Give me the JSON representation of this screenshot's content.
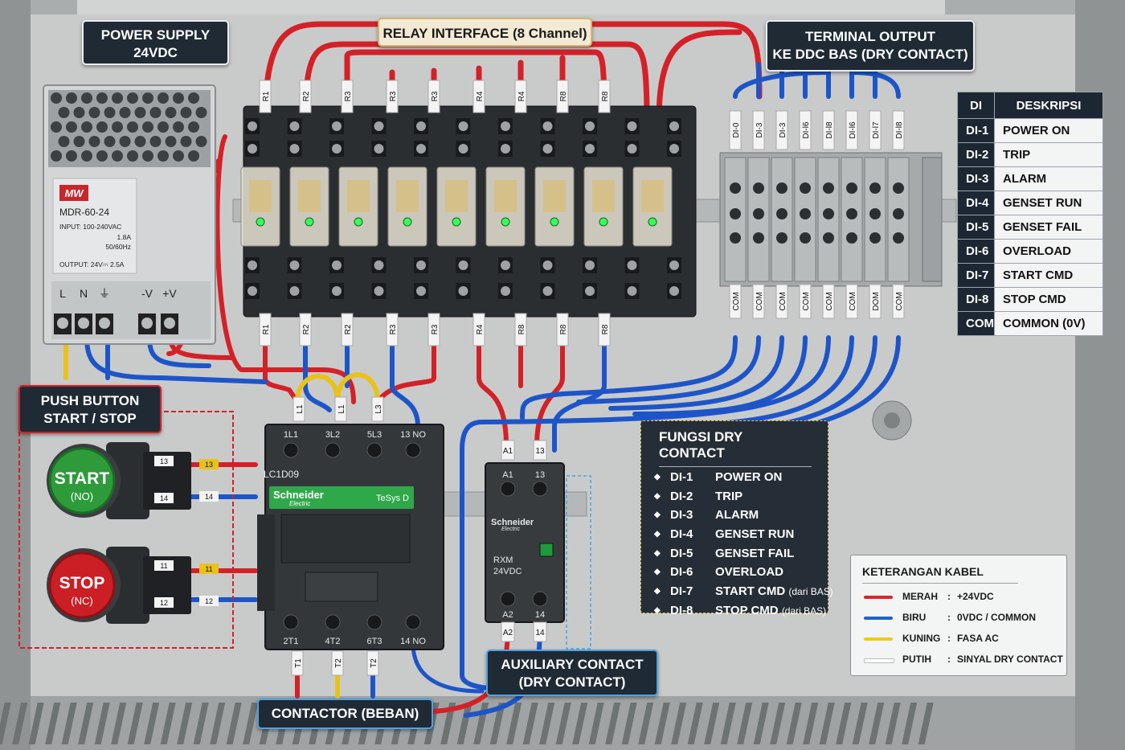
{
  "callouts": {
    "power_supply": [
      "POWER SUPPLY",
      "24VDC"
    ],
    "relay_interface": "RELAY INTERFACE (8 Channel)",
    "terminal_output": [
      "TERMINAL OUTPUT",
      "KE DDC BAS (DRY CONTACT)"
    ],
    "push_button": [
      "PUSH BUTTON",
      "START / STOP"
    ],
    "auxiliary": [
      "AUXILIARY CONTACT",
      "(DRY CONTACT)"
    ],
    "contactor": "CONTACTOR (BEBAN)"
  },
  "power_supply": {
    "brand": "MW",
    "model": "MDR-60-24",
    "input": "INPUT: 100-240VAC",
    "current": "1.8A",
    "freq": "50/60Hz",
    "output": "OUTPUT: 24V⎓ 2.5A",
    "terminals": [
      "L",
      "N",
      "⏚",
      "-V",
      "+V"
    ]
  },
  "relay_top_labels": [
    "R1",
    "R2",
    "R3",
    "R3",
    "R3",
    "R4",
    "R4",
    "R8",
    "R8"
  ],
  "relay_bottom_labels": [
    "R1",
    "R2",
    "R2",
    "R3",
    "R3",
    "R4",
    "R8",
    "R8",
    "R8"
  ],
  "terminal_top_labels": [
    "DI-0",
    "DI-3",
    "DI-3",
    "DI-l6",
    "DI-l8",
    "DI-l6",
    "DI-l7",
    "DI-l8"
  ],
  "terminal_bottom_labels": [
    "COM",
    "COM",
    "COM",
    "COM",
    "COM",
    "COM",
    "DOM",
    "COM"
  ],
  "di_table": {
    "headers": [
      "DI",
      "DESKRIPSI"
    ],
    "rows": [
      [
        "DI-1",
        "POWER ON"
      ],
      [
        "DI-2",
        "TRIP"
      ],
      [
        "DI-3",
        "ALARM"
      ],
      [
        "DI-4",
        "GENSET RUN"
      ],
      [
        "DI-5",
        "GENSET FAIL"
      ],
      [
        "DI-6",
        "OVERLOAD"
      ],
      [
        "DI-7",
        "START CMD"
      ],
      [
        "DI-8",
        "STOP CMD"
      ],
      [
        "COM",
        "COMMON (0V)"
      ]
    ]
  },
  "contactor": {
    "top_terminals": [
      "1L1",
      "3L2",
      "5L3",
      "13 NO"
    ],
    "wire_tags_top": [
      "L1",
      "L1",
      "L3"
    ],
    "model": "LC1D09",
    "brand": "Schneider",
    "brand_sub": "Electric",
    "series": "TeSys D",
    "bottom_terminals": [
      "2T1",
      "4T2",
      "6T3",
      "14 NO"
    ],
    "wire_tags_bottom": [
      "T1",
      "T2",
      "T2"
    ]
  },
  "relay_rxm": {
    "tags_top": [
      "A1",
      "13"
    ],
    "terminals_top": [
      "A1",
      "13"
    ],
    "brand": "Schneider",
    "brand_sub": "Electric",
    "model": "RXM",
    "voltage": "24VDC",
    "terminals_bottom": [
      "A2",
      "14"
    ],
    "tags_bottom": [
      "A2",
      "14"
    ]
  },
  "buttons": {
    "start": {
      "label": "START",
      "sub": "(NO)",
      "tags": [
        "13",
        "14"
      ],
      "wire_tags": [
        "13",
        "14"
      ]
    },
    "stop": {
      "label": "STOP",
      "sub": "(NC)",
      "tags": [
        "11",
        "12"
      ],
      "wire_tags": [
        "11",
        "12"
      ]
    }
  },
  "fungsi": {
    "title": "FUNGSI DRY CONTACT",
    "items": [
      {
        "di": "DI-1",
        "desc": "POWER ON",
        "note": ""
      },
      {
        "di": "DI-2",
        "desc": "TRIP",
        "note": ""
      },
      {
        "di": "DI-3",
        "desc": "ALARM",
        "note": ""
      },
      {
        "di": "DI-4",
        "desc": "GENSET RUN",
        "note": ""
      },
      {
        "di": "DI-5",
        "desc": "GENSET FAIL",
        "note": ""
      },
      {
        "di": "DI-6",
        "desc": "OVERLOAD",
        "note": ""
      },
      {
        "di": "DI-7",
        "desc": "START CMD",
        "note": "(dari BAS)"
      },
      {
        "di": "DI-8",
        "desc": "STOP CMD",
        "note": "(dari BAS)"
      }
    ]
  },
  "keterangan": {
    "title": "KETERANGAN KABEL",
    "items": [
      {
        "color": "#d9262b",
        "name": "MERAH",
        "desc": "+24VDC"
      },
      {
        "color": "#1f63d4",
        "name": "BIRU",
        "desc": "0VDC / COMMON"
      },
      {
        "color": "#f2c81f",
        "name": "KUNING",
        "desc": "FASA AC"
      },
      {
        "color": "#ffffff",
        "name": "PUTIH",
        "desc": "SINYAL DRY CONTACT"
      }
    ]
  },
  "colors": {
    "red_wire": "#d42127",
    "blue_wire": "#1d55c9",
    "yellow_wire": "#e8c21a",
    "panel": "#b9bcbd",
    "callout_bg": "#1f2a35"
  }
}
